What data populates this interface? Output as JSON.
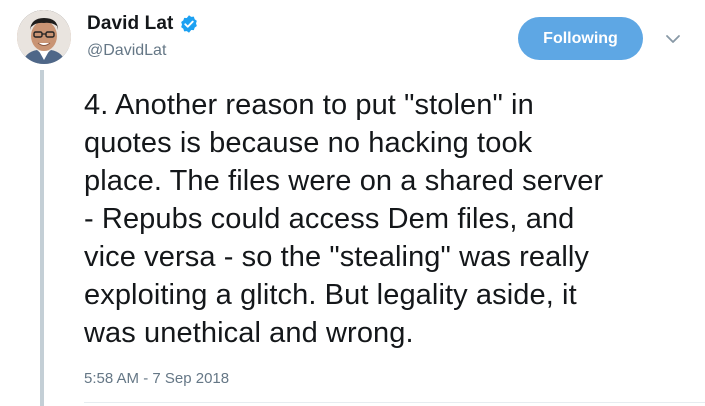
{
  "author": {
    "name": "David Lat",
    "handle": "@DavidLat",
    "verified": true,
    "avatar_icon": "profile-photo"
  },
  "follow_button": {
    "label": "Following"
  },
  "menu": {
    "icon": "chevron-down-icon"
  },
  "tweet": {
    "lines": [
      "4. Another reason to put \"stolen\" in",
      "quotes is because no hacking took",
      "place. The files were on a shared server",
      "- Repubs could access Dem files, and",
      "vice versa - so the \"stealing\" was really",
      "exploiting a glitch. But legality aside, it",
      "was unethical and wrong."
    ],
    "timestamp": "5:58 AM - 7 Sep 2018"
  },
  "colors": {
    "accent": "#5ea7e4",
    "verified_badge": "#1da1f2",
    "secondary_text": "#657786",
    "thread_line": "#c4cfd6"
  }
}
